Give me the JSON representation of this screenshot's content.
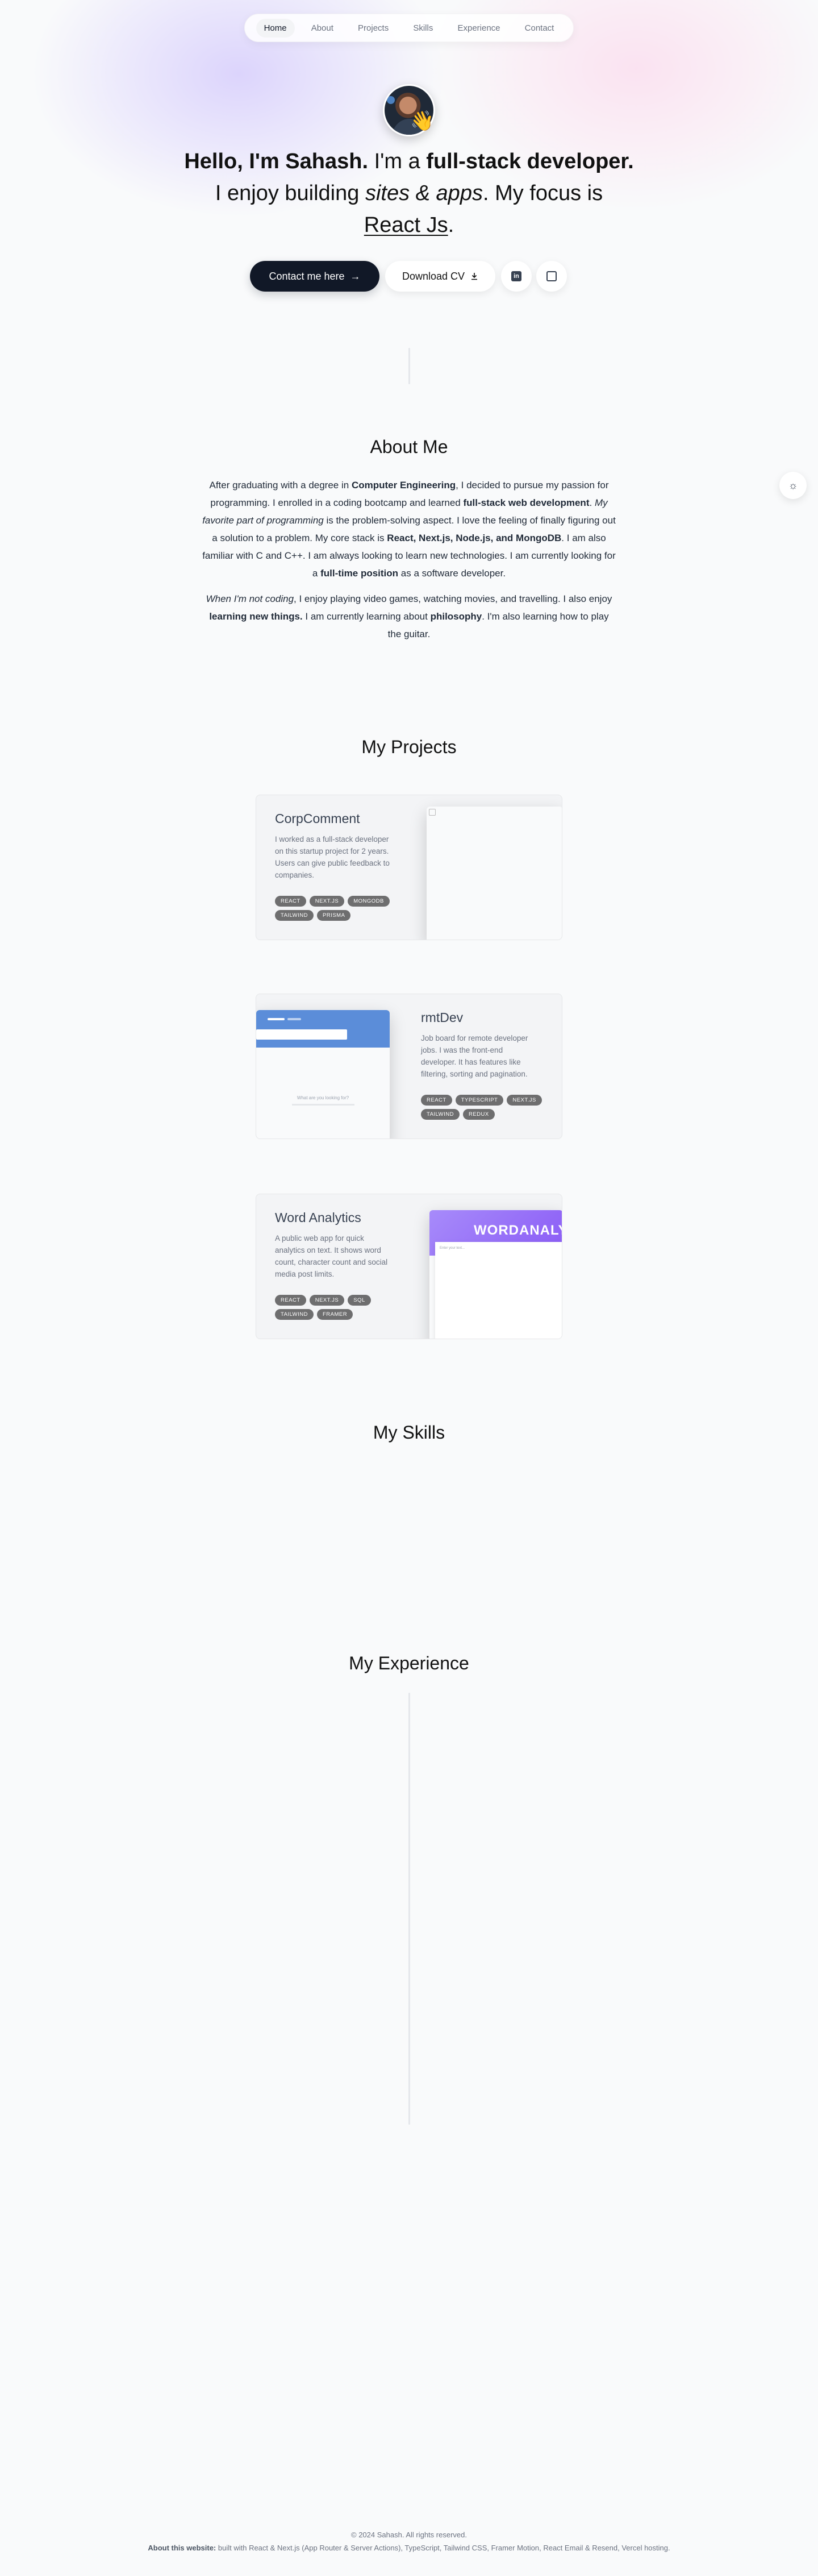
{
  "nav": {
    "items": [
      "Home",
      "About",
      "Projects",
      "Skills",
      "Experience",
      "Contact"
    ],
    "active": "Home"
  },
  "hero": {
    "wave_emoji": "👋",
    "part1_bold": "Hello, I'm Sahash.",
    "part2": " I'm a ",
    "part3_bold": "full-stack developer.",
    "part4": " I enjoy building ",
    "part5_italic": "sites & apps",
    "part6": ". My focus is ",
    "part7_underline": "React Js",
    "part8": ".",
    "contact_label": "Contact me here",
    "contact_arrow": "→",
    "cv_label": "Download CV",
    "cv_icon": "download-icon",
    "linkedin_icon": "linkedin-icon",
    "github_icon": "github-icon"
  },
  "floating": {
    "icon": "theme-toggle-icon",
    "glyph": "☼"
  },
  "about": {
    "title": "About Me",
    "p1": [
      {
        "t": "After graduating with a degree in ",
        "s": ""
      },
      {
        "t": "Computer Engineering",
        "s": "b"
      },
      {
        "t": ", I decided to pursue my passion for programming. I enrolled in a coding bootcamp and learned ",
        "s": ""
      },
      {
        "t": "full-stack web development",
        "s": "b"
      },
      {
        "t": ". ",
        "s": ""
      },
      {
        "t": "My favorite part of programming",
        "s": "i"
      },
      {
        "t": " is the problem-solving aspect. I love the feeling of finally figuring out a solution to a problem. My core stack is ",
        "s": ""
      },
      {
        "t": "React, Next.js, Node.js, and MongoDB",
        "s": "b"
      },
      {
        "t": ". I am also familiar with C and C++. I am always looking to learn new technologies. I am currently looking for a ",
        "s": ""
      },
      {
        "t": "full-time position",
        "s": "b"
      },
      {
        "t": " as a software developer.",
        "s": ""
      }
    ],
    "p2": [
      {
        "t": "When I'm not coding",
        "s": "i"
      },
      {
        "t": ", I enjoy playing video games, watching movies, and travelling. I also enjoy ",
        "s": ""
      },
      {
        "t": "learning new things.",
        "s": "b"
      },
      {
        "t": " I am currently learning about ",
        "s": ""
      },
      {
        "t": "philosophy",
        "s": "b"
      },
      {
        "t": ". I'm also learning how to play the guitar.",
        "s": ""
      }
    ]
  },
  "projects": {
    "title": "My Projects",
    "items": [
      {
        "name": "CorpComment",
        "desc": "I worked as a full-stack developer on this startup project for 2 years. Users can give public feedback to companies.",
        "tags": [
          "React",
          "Next.js",
          "MongoDB",
          "Tailwind",
          "Prisma"
        ]
      },
      {
        "name": "rmtDev",
        "desc": "Job board for remote developer jobs. I was the front-end developer. It has features like filtering, sorting and pagination.",
        "tags": [
          "React",
          "TypeScript",
          "Next.js",
          "Tailwind",
          "Redux"
        ]
      },
      {
        "name": "Word Analytics",
        "desc": "A public web app for quick analytics on text. It shows word count, character count and social media post limits.",
        "tags": [
          "React",
          "Next.js",
          "SQL",
          "Tailwind",
          "Framer"
        ]
      }
    ],
    "shots": {
      "rmtdev_tagline": "What are you looking for?",
      "wordanalytics_logo": "WORDANALYTICS",
      "wordanalytics_placeholder": "Enter your text..."
    }
  },
  "skills": {
    "title": "My Skills"
  },
  "experience": {
    "title": "My Experience"
  },
  "footer": {
    "copyright": "© 2024 Sahash. All rights reserved.",
    "about_label": "About this website:",
    "about_text": " built with React & Next.js (App Router & Server Actions), TypeScript, Tailwind CSS, Framer Motion, React Email & Resend, Vercel hosting."
  },
  "colors": {
    "accent_dark": "#111827",
    "bg": "#f9fafb",
    "glow_purple": "#c4b5fd",
    "glow_pink": "#fbcfe8",
    "tag_bg": "#6b7280",
    "wordanalytics_purple": "#8b5cf6",
    "rmtdev_blue": "#5b8dd9"
  }
}
